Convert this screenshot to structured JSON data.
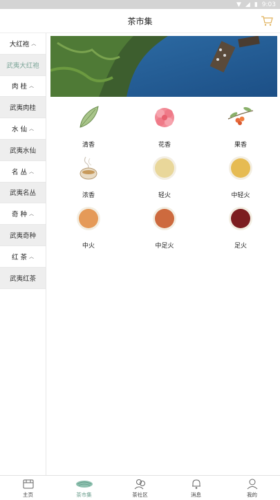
{
  "status_bar": {
    "time": "9:03"
  },
  "header": {
    "title": "茶市集"
  },
  "sidebar": {
    "items": [
      {
        "label": "大红袍",
        "type": "cat"
      },
      {
        "label": "武夷大红袍",
        "type": "sub",
        "active": true
      },
      {
        "label": "肉 桂",
        "type": "cat"
      },
      {
        "label": "武夷肉桂",
        "type": "sub"
      },
      {
        "label": "水 仙",
        "type": "cat"
      },
      {
        "label": "武夷水仙",
        "type": "sub"
      },
      {
        "label": "名 丛",
        "type": "cat"
      },
      {
        "label": "武夷名丛",
        "type": "sub"
      },
      {
        "label": "奇 种",
        "type": "cat"
      },
      {
        "label": "武夷奇种",
        "type": "sub"
      },
      {
        "label": "红 茶",
        "type": "cat"
      },
      {
        "label": "武夷红茶",
        "type": "sub"
      }
    ]
  },
  "flavors": [
    {
      "label": "清香",
      "icon": "leaf-icon"
    },
    {
      "label": "花香",
      "icon": "flower-icon"
    },
    {
      "label": "果香",
      "icon": "fruit-branch-icon"
    },
    {
      "label": "浓香",
      "icon": "teacup-icon"
    },
    {
      "label": "轻火",
      "icon": "tea-liquor-light-icon",
      "color": "#e9d79a"
    },
    {
      "label": "中轻火",
      "icon": "tea-liquor-medium-light-icon",
      "color": "#e6bb52"
    },
    {
      "label": "中火",
      "icon": "tea-liquor-medium-icon",
      "color": "#e59a58"
    },
    {
      "label": "中足火",
      "icon": "tea-liquor-medium-full-icon",
      "color": "#cd6a3e"
    },
    {
      "label": "足火",
      "icon": "tea-liquor-full-icon",
      "color": "#7c1d1f"
    }
  ],
  "tabs": [
    {
      "label": "主页",
      "icon": "home-icon"
    },
    {
      "label": "茶市集",
      "icon": "tea-market-icon",
      "active": true
    },
    {
      "label": "茶社区",
      "icon": "community-icon"
    },
    {
      "label": "消息",
      "icon": "bell-icon"
    },
    {
      "label": "我的",
      "icon": "user-icon"
    }
  ],
  "colors": {
    "accent": "#6a9d8c",
    "sidebar_sub_bg": "#eeeeee",
    "cart": "#e0b15a"
  }
}
